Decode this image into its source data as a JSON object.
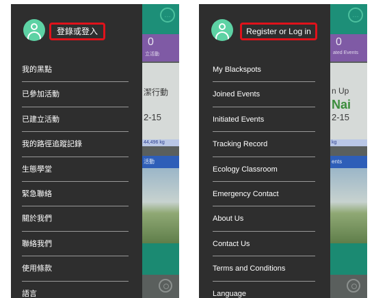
{
  "screens": [
    {
      "id": "cn",
      "login_label": "登錄或登入",
      "menu": [
        "我的黑點",
        "已參加活動",
        "已建立活動",
        "我的路徑追蹤記錄",
        "生態學堂",
        "緊急聯絡",
        "關於我們",
        "聯絡我們",
        "使用條款",
        "語言"
      ],
      "background": {
        "count": "0",
        "count_label": "立活動",
        "event_title": "潔行動",
        "event_subtitle": "",
        "event_date": "2-15",
        "stat": "44,496 kg",
        "blue_label": "活動"
      }
    },
    {
      "id": "en",
      "login_label": "Register or Log in",
      "menu": [
        "My Blackspots",
        "Joined Events",
        "Initiated Events",
        "Tracking Record",
        "Ecology Classroom",
        "Emergency Contact",
        "About Us",
        "Contact Us",
        "Terms and Conditions",
        "Language"
      ],
      "background": {
        "count": "0",
        "count_label": "ated Events",
        "event_title": "n Up",
        "event_subtitle": "Nai",
        "event_date": "2-15",
        "stat": "kg",
        "blue_label": "ents"
      }
    }
  ],
  "colors": {
    "drawer_bg": "#2e2e2e",
    "avatar": "#5dd2a4",
    "login_highlight": "#e0121b",
    "app_green": "#1d8f78",
    "app_purple": "#7f5aa5"
  },
  "icons": [
    "avatar-icon",
    "chat-icon",
    "locate-icon"
  ]
}
